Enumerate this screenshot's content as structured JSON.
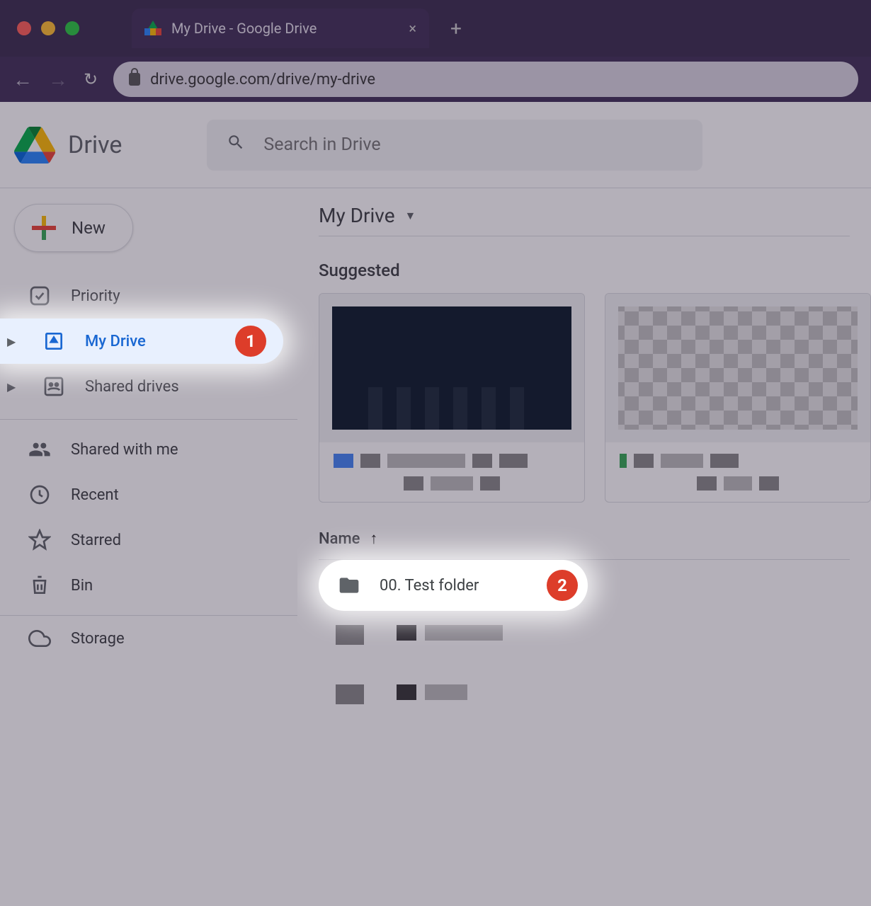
{
  "browser": {
    "tab_title": "My Drive - Google Drive",
    "url": "drive.google.com/drive/my-drive"
  },
  "header": {
    "product_name": "Drive",
    "search_placeholder": "Search in Drive"
  },
  "sidebar": {
    "new_label": "New",
    "items": [
      {
        "label": "Priority"
      },
      {
        "label": "My Drive"
      },
      {
        "label": "Shared drives"
      },
      {
        "label": "Shared with me"
      },
      {
        "label": "Recent"
      },
      {
        "label": "Starred"
      },
      {
        "label": "Bin"
      },
      {
        "label": "Storage"
      }
    ]
  },
  "main": {
    "breadcrumb": "My Drive",
    "suggested_label": "Suggested",
    "name_column": "Name",
    "sort_icon": "↑",
    "file_row_name": "00. Test folder"
  },
  "annotations": {
    "badge1": "1",
    "badge2": "2"
  }
}
